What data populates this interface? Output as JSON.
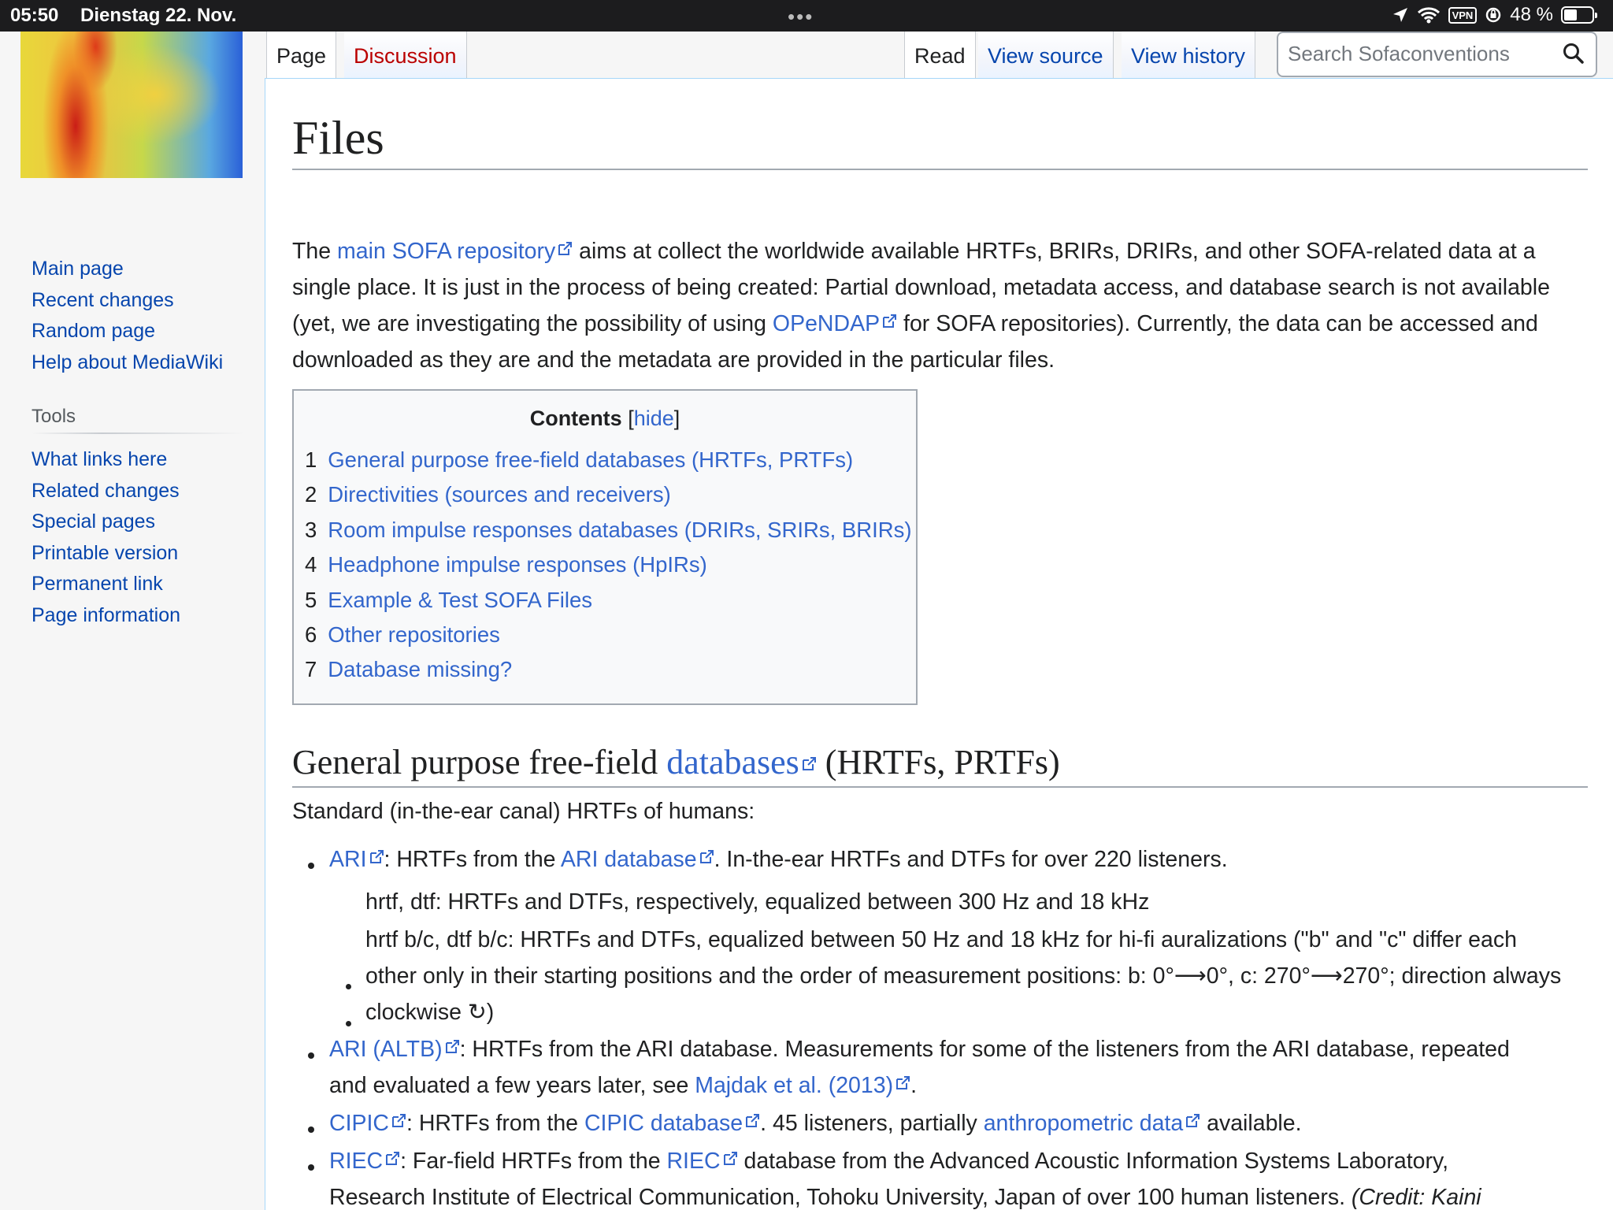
{
  "status_bar": {
    "time": "05:50",
    "date": "Dienstag 22. Nov.",
    "multitask": "•••",
    "vpn": "VPN",
    "battery": "48 %",
    "battery_level": 0.48
  },
  "sidebar": {
    "navigation": [
      "Main page",
      "Recent changes",
      "Random page",
      "Help about MediaWiki"
    ],
    "tools_heading": "Tools",
    "tools": [
      "What links here",
      "Related changes",
      "Special pages",
      "Printable version",
      "Permanent link",
      "Page information"
    ]
  },
  "tabs": {
    "page": "Page",
    "discussion": "Discussion",
    "read": "Read",
    "view_source": "View source",
    "view_history": "View history"
  },
  "search": {
    "placeholder": "Search Sofaconventions"
  },
  "page": {
    "title": "Files",
    "intro": {
      "t1": "The ",
      "link1": "main SOFA repository",
      "t2": " aims at collect the worldwide available HRTFs, BRIRs, DRIRs, and other SOFA-related data at a single place. It is just in the process of being created: Partial download, metadata access, and database search is not available (yet, we are investigating the possibility of using ",
      "link2": "OPeNDAP",
      "t3": " for SOFA repositories). Currently, the data can be accessed and downloaded as they are and the metadata are provided in the particular files."
    },
    "toc": {
      "title": "Contents",
      "hide": "hide",
      "items": [
        {
          "num": "1",
          "label": "General purpose free-field databases (HRTFs, PRTFs)"
        },
        {
          "num": "2",
          "label": "Directivities (sources and receivers)"
        },
        {
          "num": "3",
          "label": "Room impulse responses databases (DRIRs, SRIRs, BRIRs)"
        },
        {
          "num": "4",
          "label": "Headphone impulse responses (HpIRs)"
        },
        {
          "num": "5",
          "label": "Example & Test SOFA Files"
        },
        {
          "num": "6",
          "label": "Other repositories"
        },
        {
          "num": "7",
          "label": "Database missing?"
        }
      ]
    },
    "section1": {
      "h_pre": "General purpose free-field ",
      "h_link": "databases",
      "h_post": " (HRTFs, PRTFs)",
      "standard": "Standard (in-the-ear canal) HRTFs of humans:",
      "ari": {
        "link": "ARI",
        "t1": ": HRTFs from the ",
        "link2": "ARI database",
        "t2": ". In-the-ear HRTFs and DTFs for over 220 listeners."
      },
      "sub1": "hrtf, dtf: HRTFs and DTFs, respectively, equalized between 300 Hz and 18 kHz",
      "sub2a": "hrtf b/c, dtf b/c: HRTFs and DTFs, equalized between 50 Hz and 18 kHz for hi-fi auralizations (\"b\" and \"c\" differ each",
      "sub2b": "other only in their starting positions and the order of measurement positions: b: 0°⟶0°, c: 270°⟶270°; direction always",
      "sub2c": "clockwise ↻)",
      "altb": {
        "link": "ARI (ALTB)",
        "t1": ": HRTFs from the ARI database. Measurements for some of the listeners from the ARI database, repeated",
        "t2": "and evaluated a few years later, see ",
        "link2": "Majdak et al. (2013)",
        "t3": "."
      },
      "cipic": {
        "link": "CIPIC",
        "t1": ": HRTFs from the ",
        "link2": "CIPIC database",
        "t2": ". 45 listeners, partially ",
        "link3": "anthropometric data",
        "t3": " available."
      },
      "riec": {
        "link": "RIEC",
        "t1": ": Far-field HRTFs from the ",
        "link2": "RIEC",
        "t2": " database from the Advanced Acoustic Information Systems Laboratory,",
        "t3": "Research Institute of Electrical Communication, Tohoku University, Japan of over 100 human listeners. ",
        "t4": "(Credit: Kaini"
      }
    }
  }
}
